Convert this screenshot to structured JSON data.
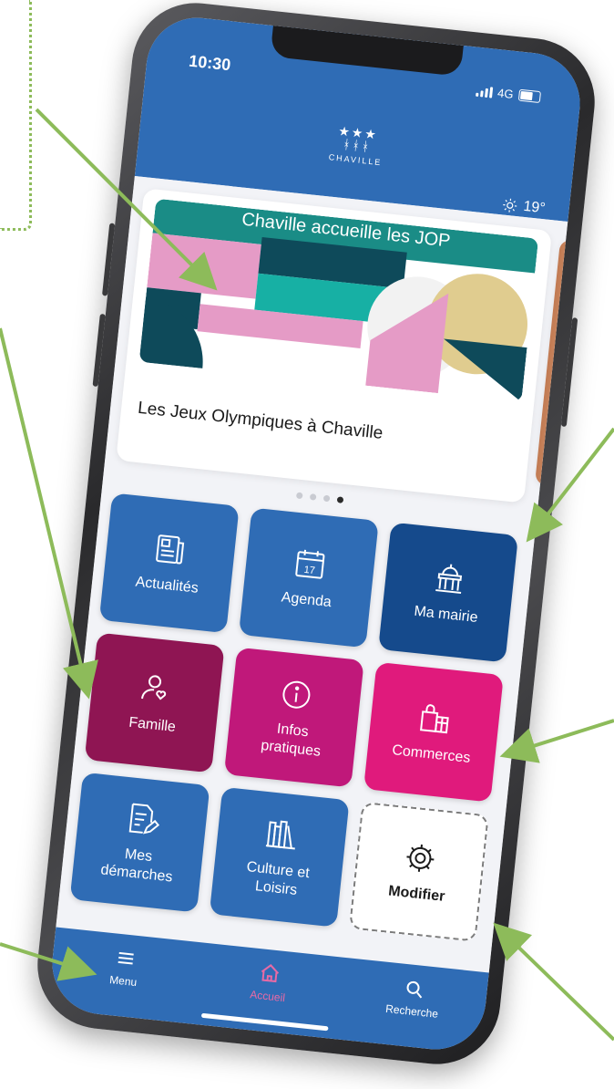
{
  "status_bar": {
    "time": "10:30",
    "network": "4G"
  },
  "header": {
    "logo_text": "CHAVILLE",
    "logo_stars": "★★★",
    "weather_temp": "19°"
  },
  "banner": {
    "title": "Chaville accueille les JOP",
    "caption": "Les Jeux Olympiques à Chaville",
    "pager_count": 4,
    "pager_active_index": 3
  },
  "tiles": [
    {
      "label": "Actualités",
      "icon": "newspaper-icon",
      "color": "#2f6cb5"
    },
    {
      "label": "Agenda",
      "icon": "calendar-icon",
      "calendar_day": "17",
      "color": "#2f6cb5"
    },
    {
      "label": "Ma mairie",
      "icon": "town-hall-icon",
      "color": "#154a8c"
    },
    {
      "label": "Famille",
      "icon": "family-icon",
      "color": "#8f1553"
    },
    {
      "label_line1": "Infos",
      "label_line2": "pratiques",
      "icon": "info-icon",
      "color": "#c0187a"
    },
    {
      "label": "Commerces",
      "icon": "shops-icon",
      "color": "#e01a7c"
    },
    {
      "label_line1": "Mes",
      "label_line2": "démarches",
      "icon": "document-edit-icon",
      "color": "#2f6cb5"
    },
    {
      "label_line1": "Culture et",
      "label_line2": "Loisirs",
      "icon": "library-icon",
      "color": "#2f6cb5"
    },
    {
      "label": "Modifier",
      "icon": "gear-icon"
    }
  ],
  "bottom_nav": [
    {
      "label": "Menu",
      "icon": "hamburger-icon"
    },
    {
      "label": "Accueil",
      "icon": "home-icon"
    },
    {
      "label": "Recherche",
      "icon": "search-icon"
    }
  ],
  "colors": {
    "primary": "#2f6cb5",
    "dark_blue": "#154a8c",
    "accent_pink": "#e86aa5",
    "annotation_green": "#8dbb5a"
  }
}
